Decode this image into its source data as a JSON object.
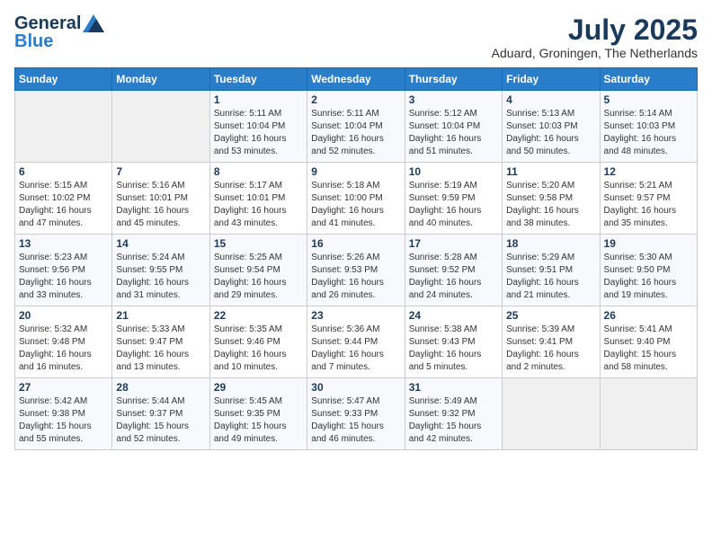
{
  "header": {
    "logo_line1": "General",
    "logo_line2": "Blue",
    "title": "July 2025",
    "location": "Aduard, Groningen, The Netherlands"
  },
  "calendar": {
    "days_of_week": [
      "Sunday",
      "Monday",
      "Tuesday",
      "Wednesday",
      "Thursday",
      "Friday",
      "Saturday"
    ],
    "weeks": [
      [
        {
          "day": "",
          "info": ""
        },
        {
          "day": "",
          "info": ""
        },
        {
          "day": "1",
          "info": "Sunrise: 5:11 AM\nSunset: 10:04 PM\nDaylight: 16 hours\nand 53 minutes."
        },
        {
          "day": "2",
          "info": "Sunrise: 5:11 AM\nSunset: 10:04 PM\nDaylight: 16 hours\nand 52 minutes."
        },
        {
          "day": "3",
          "info": "Sunrise: 5:12 AM\nSunset: 10:04 PM\nDaylight: 16 hours\nand 51 minutes."
        },
        {
          "day": "4",
          "info": "Sunrise: 5:13 AM\nSunset: 10:03 PM\nDaylight: 16 hours\nand 50 minutes."
        },
        {
          "day": "5",
          "info": "Sunrise: 5:14 AM\nSunset: 10:03 PM\nDaylight: 16 hours\nand 48 minutes."
        }
      ],
      [
        {
          "day": "6",
          "info": "Sunrise: 5:15 AM\nSunset: 10:02 PM\nDaylight: 16 hours\nand 47 minutes."
        },
        {
          "day": "7",
          "info": "Sunrise: 5:16 AM\nSunset: 10:01 PM\nDaylight: 16 hours\nand 45 minutes."
        },
        {
          "day": "8",
          "info": "Sunrise: 5:17 AM\nSunset: 10:01 PM\nDaylight: 16 hours\nand 43 minutes."
        },
        {
          "day": "9",
          "info": "Sunrise: 5:18 AM\nSunset: 10:00 PM\nDaylight: 16 hours\nand 41 minutes."
        },
        {
          "day": "10",
          "info": "Sunrise: 5:19 AM\nSunset: 9:59 PM\nDaylight: 16 hours\nand 40 minutes."
        },
        {
          "day": "11",
          "info": "Sunrise: 5:20 AM\nSunset: 9:58 PM\nDaylight: 16 hours\nand 38 minutes."
        },
        {
          "day": "12",
          "info": "Sunrise: 5:21 AM\nSunset: 9:57 PM\nDaylight: 16 hours\nand 35 minutes."
        }
      ],
      [
        {
          "day": "13",
          "info": "Sunrise: 5:23 AM\nSunset: 9:56 PM\nDaylight: 16 hours\nand 33 minutes."
        },
        {
          "day": "14",
          "info": "Sunrise: 5:24 AM\nSunset: 9:55 PM\nDaylight: 16 hours\nand 31 minutes."
        },
        {
          "day": "15",
          "info": "Sunrise: 5:25 AM\nSunset: 9:54 PM\nDaylight: 16 hours\nand 29 minutes."
        },
        {
          "day": "16",
          "info": "Sunrise: 5:26 AM\nSunset: 9:53 PM\nDaylight: 16 hours\nand 26 minutes."
        },
        {
          "day": "17",
          "info": "Sunrise: 5:28 AM\nSunset: 9:52 PM\nDaylight: 16 hours\nand 24 minutes."
        },
        {
          "day": "18",
          "info": "Sunrise: 5:29 AM\nSunset: 9:51 PM\nDaylight: 16 hours\nand 21 minutes."
        },
        {
          "day": "19",
          "info": "Sunrise: 5:30 AM\nSunset: 9:50 PM\nDaylight: 16 hours\nand 19 minutes."
        }
      ],
      [
        {
          "day": "20",
          "info": "Sunrise: 5:32 AM\nSunset: 9:48 PM\nDaylight: 16 hours\nand 16 minutes."
        },
        {
          "day": "21",
          "info": "Sunrise: 5:33 AM\nSunset: 9:47 PM\nDaylight: 16 hours\nand 13 minutes."
        },
        {
          "day": "22",
          "info": "Sunrise: 5:35 AM\nSunset: 9:46 PM\nDaylight: 16 hours\nand 10 minutes."
        },
        {
          "day": "23",
          "info": "Sunrise: 5:36 AM\nSunset: 9:44 PM\nDaylight: 16 hours\nand 7 minutes."
        },
        {
          "day": "24",
          "info": "Sunrise: 5:38 AM\nSunset: 9:43 PM\nDaylight: 16 hours\nand 5 minutes."
        },
        {
          "day": "25",
          "info": "Sunrise: 5:39 AM\nSunset: 9:41 PM\nDaylight: 16 hours\nand 2 minutes."
        },
        {
          "day": "26",
          "info": "Sunrise: 5:41 AM\nSunset: 9:40 PM\nDaylight: 15 hours\nand 58 minutes."
        }
      ],
      [
        {
          "day": "27",
          "info": "Sunrise: 5:42 AM\nSunset: 9:38 PM\nDaylight: 15 hours\nand 55 minutes."
        },
        {
          "day": "28",
          "info": "Sunrise: 5:44 AM\nSunset: 9:37 PM\nDaylight: 15 hours\nand 52 minutes."
        },
        {
          "day": "29",
          "info": "Sunrise: 5:45 AM\nSunset: 9:35 PM\nDaylight: 15 hours\nand 49 minutes."
        },
        {
          "day": "30",
          "info": "Sunrise: 5:47 AM\nSunset: 9:33 PM\nDaylight: 15 hours\nand 46 minutes."
        },
        {
          "day": "31",
          "info": "Sunrise: 5:49 AM\nSunset: 9:32 PM\nDaylight: 15 hours\nand 42 minutes."
        },
        {
          "day": "",
          "info": ""
        },
        {
          "day": "",
          "info": ""
        }
      ]
    ]
  }
}
